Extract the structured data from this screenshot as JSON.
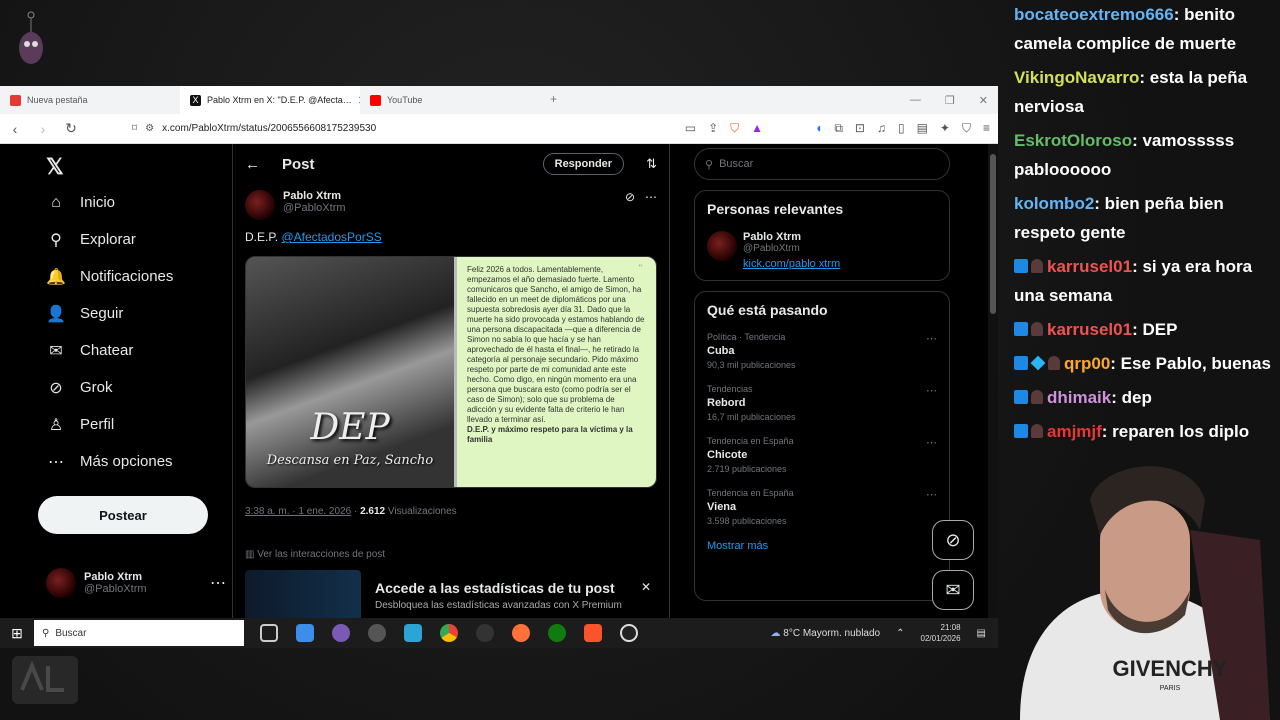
{
  "browser": {
    "tabs": [
      {
        "label": "Nueva pestaña",
        "color": "#e53935"
      },
      {
        "label": "Pablo Xtrm en X: \"D.E.P. @Afecta…",
        "color": "#111111"
      },
      {
        "label": "YouTube",
        "color": "#ff0000"
      }
    ],
    "url": "x.com/PabloXtrm/status/2006556608175239530"
  },
  "x": {
    "nav": [
      {
        "icon": "home-icon",
        "glyph": "⌂",
        "label": "Inicio"
      },
      {
        "icon": "search-icon",
        "glyph": "⚲",
        "label": "Explorar"
      },
      {
        "icon": "bell-icon",
        "glyph": "🔔",
        "label": "Notificaciones"
      },
      {
        "icon": "follow-icon",
        "glyph": "👤",
        "label": "Seguir"
      },
      {
        "icon": "mail-icon",
        "glyph": "✉",
        "label": "Chatear"
      },
      {
        "icon": "grok-icon",
        "glyph": "⊘",
        "label": "Grok"
      },
      {
        "icon": "person-icon",
        "glyph": "♙",
        "label": "Perfil"
      },
      {
        "icon": "more-icon",
        "glyph": "⋯",
        "label": "Más opciones"
      }
    ],
    "post_button": "Postear",
    "account": {
      "name": "Pablo Xtrm",
      "handle": "@PabloXtrm"
    },
    "header_title": "Post",
    "reply_button": "Responder",
    "post": {
      "author": "Pablo Xtrm",
      "handle": "@PabloXtrm",
      "text_prefix": "D.E.P.",
      "mention": "@AfectadosPorSS",
      "image_title": "DEP",
      "image_caption": "Descansa en Paz, Sancho",
      "note": "Feliz 2026 a todos. Lamentablemente, empezamos el año demasiado fuerte. Lamento comunicaros que Sancho, el amigo de Simon, ha fallecido en un meet de diplomáticos por una supuesta sobredosis ayer día 31. Dado que la muerte ha sido provocada y estamos hablando de una persona discapacitada —que a diferencia de Simon no sabía lo que hacía y se han aprovechado de él hasta el final—, he retirado la categoría al personaje secundario. Pido máximo respeto por parte de mi comunidad ante este hecho. Como digo, en ningún momento era una persona que buscara esto (como podría ser el caso de Simon); solo que su problema de adicción y su evidente falta de criterio le han llevado a terminar así.",
      "note_bold": "D.E.P. y máximo respeto para la víctima y la familia",
      "time": "3:38 a. m. · 1 ene. 2026",
      "views_count": "2.612",
      "views_label": "Visualizaciones",
      "interactions": "Ver las interacciones de post"
    },
    "promo": {
      "title": "Accede a las estadísticas de tu post",
      "subtitle": "Desbloquea las estadísticas avanzadas con X Premium"
    },
    "search_placeholder": "Buscar",
    "relevant": {
      "title": "Personas relevantes",
      "name": "Pablo Xtrm",
      "handle": "@PabloXtrm",
      "link": "kick.com/pablo xtrm"
    },
    "trending": {
      "title": "Qué está pasando",
      "items": [
        {
          "context": "Política · Tendencia",
          "name": "Cuba",
          "posts": "90,3 mil publicaciones"
        },
        {
          "context": "Tendencias",
          "name": "Rebord",
          "posts": "16,7 mil publicaciones"
        },
        {
          "context": "Tendencia en España",
          "name": "Chicote",
          "posts": "2.719 publicaciones"
        },
        {
          "context": "Tendencia en España",
          "name": "Viena",
          "posts": "3.598 publicaciones"
        }
      ],
      "more": "Mostrar más"
    }
  },
  "taskbar": {
    "search": "Buscar",
    "weather": "8°C  Mayorm. nublado",
    "time": "21:08",
    "date": "02/01/2026"
  },
  "chat": [
    {
      "user": "bocateoextremo666",
      "color": "#64b5f6",
      "text": ": benito camela complice de muerte",
      "badges": 0
    },
    {
      "user": "VikingoNavarro",
      "color": "#d4e157",
      "text": ": esta la peña nerviosa",
      "badges": 0
    },
    {
      "user": "EskrotOloroso",
      "color": "#66bb6a",
      "text": ": vamosssss pabloooooo",
      "badges": 0
    },
    {
      "user": "kolombo2",
      "color": "#64b5f6",
      "text": ": bien peña bien respeto gente",
      "badges": 0
    },
    {
      "user": "karrusel01",
      "color": "#ef5350",
      "text": ": si ya era hora una semana",
      "badges": 2
    },
    {
      "user": "karrusel01",
      "color": "#ef5350",
      "text": ": DEP",
      "badges": 2
    },
    {
      "user": "qrp00",
      "color": "#ffa726",
      "text": ": Ese Pablo, buenas",
      "badges": 3
    },
    {
      "user": "dhimaik",
      "color": "#ce93d8",
      "text": ": dep",
      "badges": 1
    },
    {
      "user": "amjmjf",
      "color": "#e53935",
      "text": ": reparen los diplo",
      "badges": 1
    }
  ],
  "cam": {
    "shirt_text": "GIVENCHY",
    "shirt_sub": "PARIS"
  }
}
